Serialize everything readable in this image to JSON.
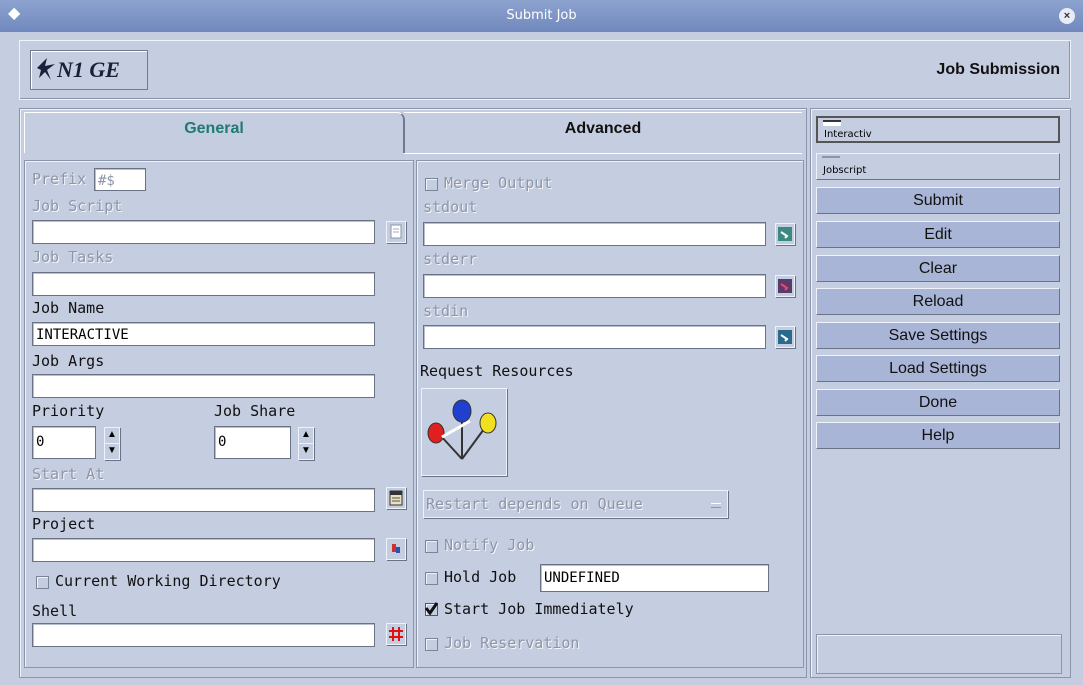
{
  "window": {
    "title": "Submit Job"
  },
  "header": {
    "logo_text": "N1 GE",
    "heading": "Job Submission"
  },
  "tabs": [
    {
      "label": "General"
    },
    {
      "label": "Advanced"
    }
  ],
  "general": {
    "prefix_label": "Prefix",
    "prefix_value": "#$",
    "job_script_label": "Job Script",
    "job_tasks_label": "Job Tasks",
    "job_name_label": "Job Name",
    "job_name_value": "INTERACTIVE",
    "job_args_label": "Job Args",
    "priority_label": "Priority",
    "priority_value": "0",
    "job_share_label": "Job Share",
    "job_share_value": "0",
    "start_at_label": "Start At",
    "project_label": "Project",
    "cwd_label": "Current Working Directory",
    "shell_label": "Shell"
  },
  "advanced": {
    "merge_output_label": "Merge Output",
    "stdout_label": "stdout",
    "stderr_label": "stderr",
    "stdin_label": "stdin",
    "request_resources_label": "Request Resources",
    "restart_label": "Restart depends on Queue",
    "notify_job_label": "Notify Job",
    "hold_job_label": "Hold Job",
    "hold_job_value": "UNDEFINED",
    "start_immediately_label": "Start Job Immediately",
    "start_immediately_checked": true,
    "reservation_label": "Job Reservation"
  },
  "sidebar": {
    "modes": [
      {
        "label": "Interactiv"
      },
      {
        "label": "Jobscript"
      }
    ],
    "buttons": [
      {
        "label": "Submit"
      },
      {
        "label": "Edit"
      },
      {
        "label": "Clear"
      },
      {
        "label": "Reload"
      },
      {
        "label": "Save Settings"
      },
      {
        "label": "Load Settings"
      },
      {
        "label": "Done"
      },
      {
        "label": "Help"
      }
    ]
  },
  "colors": {
    "background": "#c5cde0",
    "active_tab_text": "#1f7a70",
    "button_face": "#a9b5d6"
  }
}
